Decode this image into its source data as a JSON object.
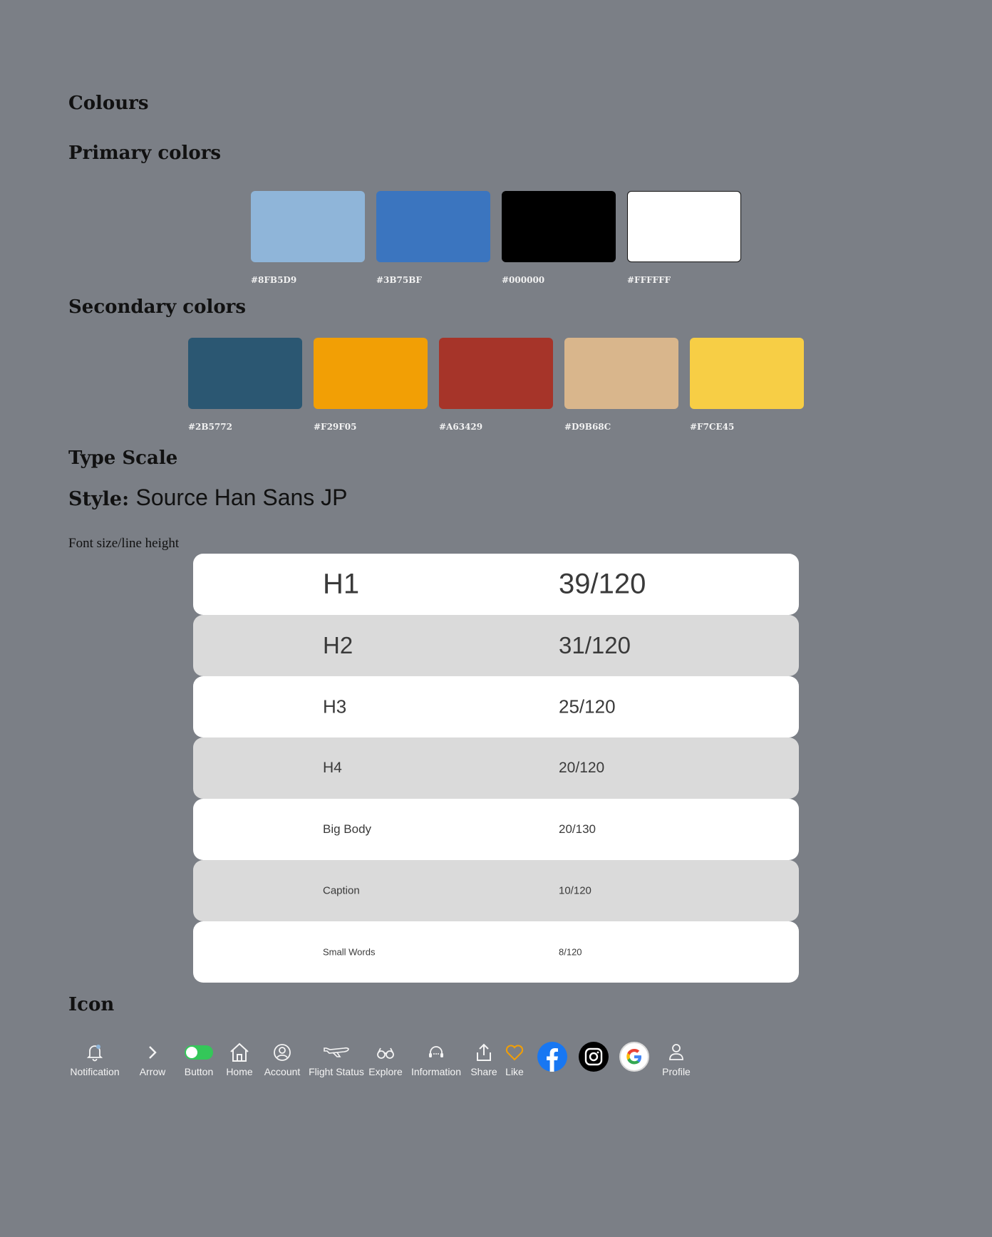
{
  "sections": {
    "colours": "Colours",
    "primary": "Primary colors",
    "secondary": "Secondary colors",
    "type_scale": "Type Scale",
    "style_label": "Style:",
    "style_font": "Source Han Sans JP",
    "font_size_label": "Font size/line height",
    "icon": "Icon"
  },
  "primary_colors": [
    {
      "hex": "#8FB5D9"
    },
    {
      "hex": "#3B75BF"
    },
    {
      "hex": "#000000"
    },
    {
      "hex": "#FFFFFF"
    }
  ],
  "secondary_colors": [
    {
      "hex": "#2B5772"
    },
    {
      "hex": "#F29F05"
    },
    {
      "hex": "#A63429"
    },
    {
      "hex": "#D9B68C"
    },
    {
      "hex": "#F7CE45"
    }
  ],
  "type_scale": [
    {
      "name": "H1",
      "metric": "39/120"
    },
    {
      "name": "H2",
      "metric": "31/120"
    },
    {
      "name": "H3",
      "metric": "25/120"
    },
    {
      "name": "H4",
      "metric": "20/120"
    },
    {
      "name": "Big Body",
      "metric": "20/130"
    },
    {
      "name": "Caption",
      "metric": "10/120"
    },
    {
      "name": "Small Words",
      "metric": "8/120"
    }
  ],
  "icons": {
    "notification": "Notification",
    "arrow": "Arrow",
    "button": "Button",
    "home": "Home",
    "account": "Account",
    "flight_status": "Flight Status",
    "explore": "Explore",
    "information": "Information",
    "share": "Share",
    "like": "Like",
    "profile": "Profile"
  },
  "icon_colors": {
    "toggle": "#34C759",
    "like": "#F29F05",
    "facebook": "#1877F2",
    "instagram": "#000000",
    "google_bg": "#FFFFFF"
  }
}
